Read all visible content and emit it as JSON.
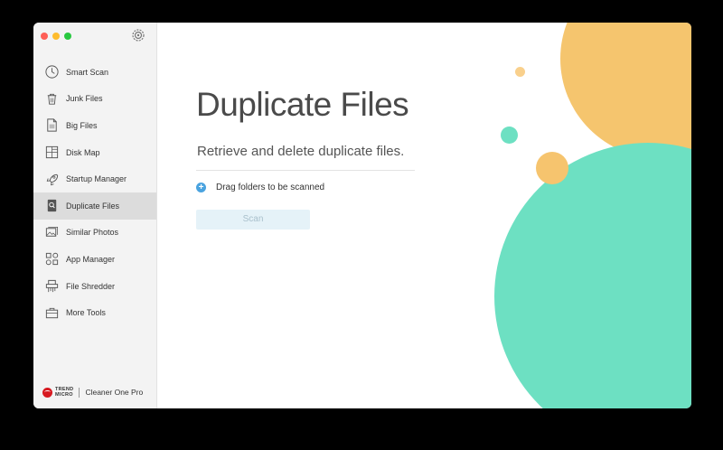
{
  "sidebar": {
    "items": [
      {
        "label": "Smart Scan",
        "icon": "clock-icon",
        "active": false
      },
      {
        "label": "Junk Files",
        "icon": "trash-icon",
        "active": false
      },
      {
        "label": "Big Files",
        "icon": "big-file-icon",
        "active": false
      },
      {
        "label": "Disk Map",
        "icon": "disk-map-icon",
        "active": false
      },
      {
        "label": "Startup Manager",
        "icon": "rocket-icon",
        "active": false
      },
      {
        "label": "Duplicate Files",
        "icon": "duplicate-files-icon",
        "active": true
      },
      {
        "label": "Similar Photos",
        "icon": "photos-icon",
        "active": false
      },
      {
        "label": "App Manager",
        "icon": "apps-icon",
        "active": false
      },
      {
        "label": "File Shredder",
        "icon": "shredder-icon",
        "active": false
      },
      {
        "label": "More Tools",
        "icon": "toolbox-icon",
        "active": false
      }
    ],
    "brand": {
      "logo_text": "TREND MICRO",
      "product": "Cleaner One Pro"
    }
  },
  "main": {
    "title": "Duplicate Files",
    "subtitle": "Retrieve and delete duplicate files.",
    "drag_label": "Drag folders to be scanned",
    "plus_symbol": "+",
    "scan_label": "Scan"
  },
  "colors": {
    "accent_blue": "#4aa3df",
    "orange": "#f4c266",
    "teal": "#6de0c2",
    "scan_button_bg": "#e5f2f8"
  }
}
